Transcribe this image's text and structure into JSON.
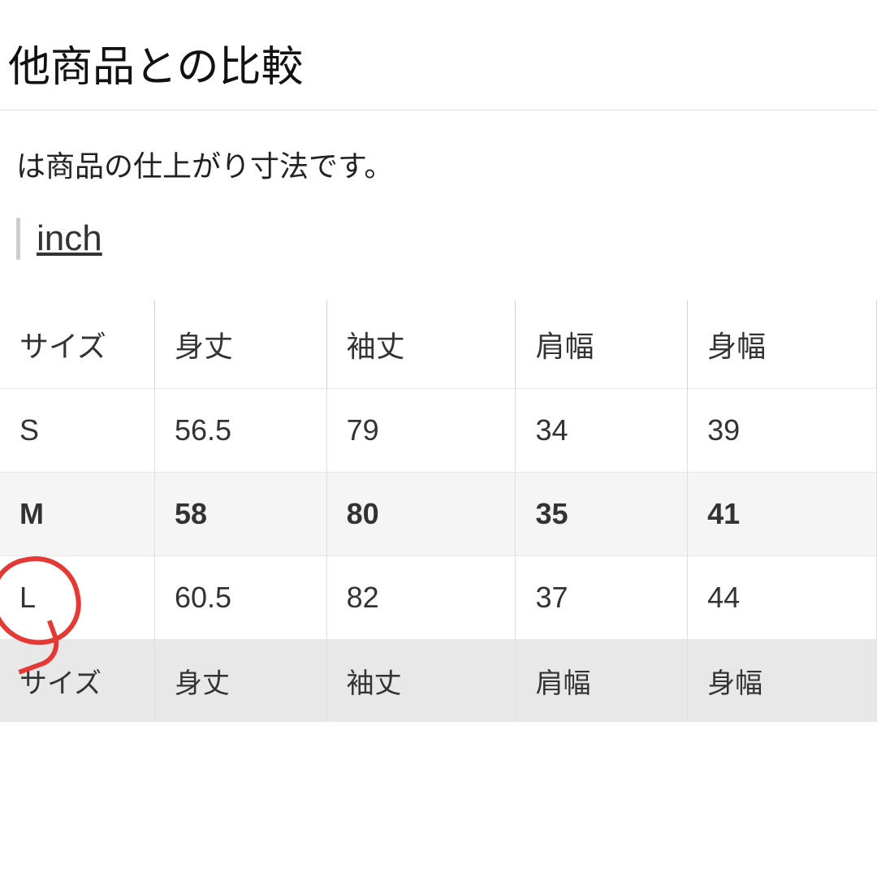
{
  "title": "他商品との比較",
  "subtitle": "は商品の仕上がり寸法です。",
  "unit_toggle": {
    "label": "inch"
  },
  "table": {
    "headers": [
      "サイズ",
      "身丈",
      "袖丈",
      "肩幅",
      "身幅"
    ],
    "rows": [
      {
        "size": "S",
        "body": "56.5",
        "sleeve": "79",
        "shoulder": "34",
        "chest": "39",
        "bold": false
      },
      {
        "size": "M",
        "body": "58",
        "sleeve": "80",
        "shoulder": "35",
        "chest": "41",
        "bold": true
      },
      {
        "size": "L",
        "body": "60.5",
        "sleeve": "82",
        "shoulder": "37",
        "chest": "44",
        "bold": false
      }
    ],
    "bottom_headers": [
      "サイズ",
      "身丈",
      "袖丈",
      "肩幅",
      "身幅"
    ]
  }
}
